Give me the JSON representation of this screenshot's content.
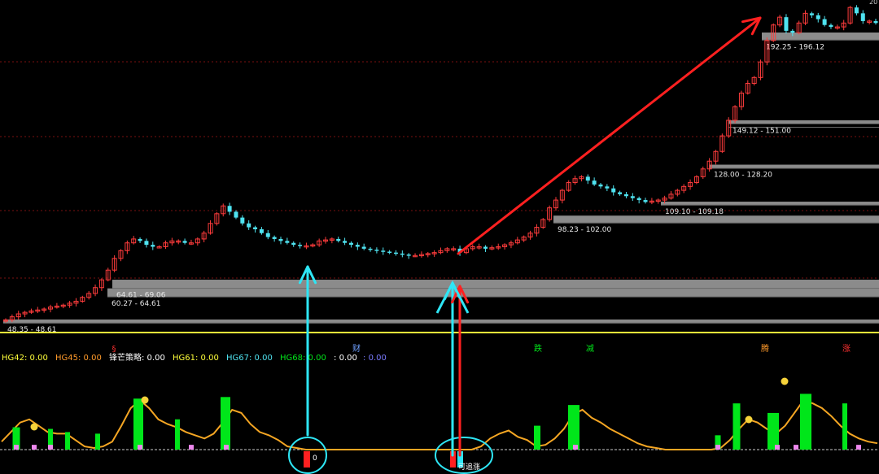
{
  "colors": {
    "background": "#000000",
    "up": "#ff3c3c",
    "down": "#4fe3f0",
    "level": "#9a9a9a",
    "divider": "#ffff3a",
    "curve": "#f5a623",
    "green_bar": "#00e61a",
    "pink_bar": "#ee88ee",
    "cyan_arrow": "#2ee6f5",
    "red_arrow": "#ff2020",
    "grid": "#7a1010"
  },
  "indicator_bar": [
    {
      "text": "HG42: 0.00",
      "color": "#ffff3a"
    },
    {
      "text": "HG45: 0.00",
      "color": "#ff9a2a"
    },
    {
      "text": "锋芒策略: 0.00",
      "color": "#ffffff"
    },
    {
      "text": "HG61: 0.00",
      "color": "#ffff3a"
    },
    {
      "text": "HG67: 0.00",
      "color": "#4fe3f0"
    },
    {
      "text": "HG68: 0.00",
      "color": "#00e61a"
    },
    {
      "text": ": 0.00",
      "color": "#ffffff"
    },
    {
      "text": ": 0.00",
      "color": "#7a7aff"
    }
  ],
  "signal_marks": [
    {
      "text": "§",
      "color": "#ff3030"
    },
    {
      "text": "财",
      "color": "#6fa0ff"
    },
    {
      "text": "跌",
      "color": "#00e61a"
    },
    {
      "text": "减",
      "color": "#00e61a"
    },
    {
      "text": "腾",
      "color": "#ff9a2a"
    },
    {
      "text": "涨",
      "color": "#ff3030"
    }
  ],
  "sub_labels": {
    "left_mark": "0",
    "chase": "可追涨",
    "top_right": "20"
  },
  "chart_data": {
    "type": "candlestick",
    "title": "",
    "ylim": [
      44,
      212
    ],
    "levels": [
      {
        "label": "48.35 - 48.61",
        "low": 48.35,
        "high": 48.61
      },
      {
        "label": "60.27 - 64.61",
        "low": 60.27,
        "high": 64.61
      },
      {
        "label": "64.61 - 69.06",
        "low": 64.61,
        "high": 69.06
      },
      {
        "label": "98.23 - 102.00",
        "low": 98.23,
        "high": 102.0
      },
      {
        "label": "109.10 - 109.18",
        "low": 109.1,
        "high": 109.18
      },
      {
        "label": "128.00 - 128.20",
        "low": 128.0,
        "high": 128.2
      },
      {
        "label": "149.12 - 151.00",
        "low": 149.12,
        "high": 151.0
      },
      {
        "label": "192.25 - 196.12",
        "low": 192.25,
        "high": 196.12
      }
    ],
    "close": [
      48.4,
      50,
      51.5,
      52.3,
      53,
      53.5,
      54,
      55,
      55.5,
      56,
      57,
      58,
      60,
      62,
      65,
      69,
      74,
      80,
      84,
      88,
      90,
      89,
      87,
      86,
      86,
      88,
      89,
      89,
      88,
      88,
      90,
      93,
      98,
      103,
      107,
      104,
      101,
      98,
      96,
      95,
      93,
      91,
      90,
      89,
      88,
      87,
      86.5,
      86.5,
      87,
      89,
      89.5,
      90,
      89,
      88,
      87,
      86,
      85,
      84.5,
      84,
      83.5,
      83,
      82.5,
      82,
      81.5,
      81.5,
      82,
      82.5,
      83,
      84,
      85,
      85,
      83,
      85,
      86,
      86,
      85,
      85.5,
      86,
      87,
      88,
      89.5,
      91,
      93,
      96,
      100,
      106,
      110,
      115,
      119,
      121,
      122,
      120,
      118,
      117,
      116,
      114,
      113,
      112,
      111,
      110,
      109,
      109.5,
      110,
      111,
      113,
      115,
      117,
      119,
      122,
      126,
      130,
      135,
      143,
      151,
      158,
      165,
      170,
      173,
      181,
      192,
      200,
      204,
      197,
      196,
      201,
      206,
      205,
      203,
      200,
      199,
      199,
      201,
      209,
      206,
      202,
      202,
      201
    ],
    "indicator": {
      "curve": [
        0.1,
        0.22,
        0.34,
        0.38,
        0.3,
        0.22,
        0.2,
        0.2,
        0.12,
        0.04,
        0.02,
        0.04,
        0.1,
        0.3,
        0.52,
        0.62,
        0.52,
        0.38,
        0.32,
        0.28,
        0.22,
        0.18,
        0.14,
        0.2,
        0.34,
        0.5,
        0.46,
        0.32,
        0.22,
        0.18,
        0.12,
        0.04,
        0.02,
        0,
        0,
        0,
        0,
        0,
        0,
        0,
        0,
        0,
        0,
        0,
        0,
        0,
        0,
        0,
        0,
        0,
        0,
        0,
        0.04,
        0.14,
        0.2,
        0.24,
        0.16,
        0.12,
        0.04,
        0.06,
        0.14,
        0.26,
        0.44,
        0.5,
        0.4,
        0.34,
        0.26,
        0.2,
        0.14,
        0.08,
        0.04,
        0.02,
        0,
        0,
        0,
        0,
        0,
        0,
        0.02,
        0.12,
        0.26,
        0.38,
        0.34,
        0.26,
        0.2,
        0.3,
        0.46,
        0.62,
        0.58,
        0.52,
        0.42,
        0.3,
        0.2,
        0.14,
        0.1,
        0.08
      ],
      "green_bars": [
        0.28,
        0.26,
        0.22,
        0.2,
        0.64,
        0.38,
        0.66,
        0.3,
        0.56,
        0.18,
        0.58,
        0.46,
        0.7,
        0.58
      ],
      "pink_bars": [
        0.06,
        0.06,
        0.06,
        0.06,
        0.06,
        0.06,
        0.06,
        0.06,
        0.06,
        0.06,
        0.06
      ]
    }
  }
}
